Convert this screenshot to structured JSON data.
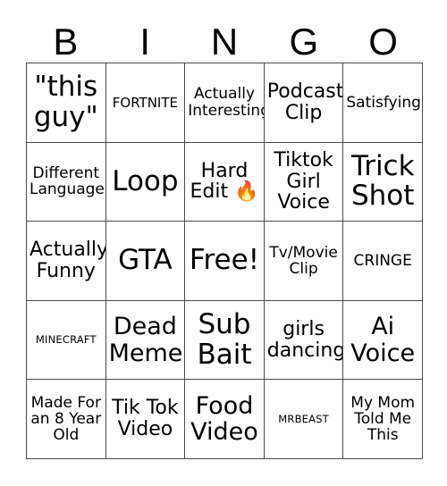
{
  "card": {
    "header": {
      "letters": [
        "B",
        "I",
        "N",
        "G",
        "O"
      ]
    },
    "rows": [
      [
        {
          "text": "\"this guy\"",
          "size": "sz-xl"
        },
        {
          "text": "FORTNITE",
          "size": "sz-xs"
        },
        {
          "text": "Actually Interesting",
          "size": "sz-sm"
        },
        {
          "text": "Podcast Clip",
          "size": "sz-md"
        },
        {
          "text": "Satisfying",
          "size": "sz-sm"
        }
      ],
      [
        {
          "text": "Different Language",
          "size": "sz-sm"
        },
        {
          "text": "Loop",
          "size": "sz-xl"
        },
        {
          "text": "Hard Edit 🔥",
          "size": "sz-md"
        },
        {
          "text": "Tiktok Girl Voice",
          "size": "sz-md"
        },
        {
          "text": "Trick Shot",
          "size": "sz-xl"
        }
      ],
      [
        {
          "text": "Actually Funny",
          "size": "sz-md"
        },
        {
          "text": "GTA",
          "size": "sz-xl"
        },
        {
          "text": "Free!",
          "size": "sz-xl"
        },
        {
          "text": "Tv/Movie Clip",
          "size": "sz-sm"
        },
        {
          "text": "CRINGE",
          "size": "sz-sm"
        }
      ],
      [
        {
          "text": "MINECRAFT",
          "size": "sz-xxs"
        },
        {
          "text": "Dead Meme",
          "size": "sz-lg"
        },
        {
          "text": "Sub Bait",
          "size": "sz-xl"
        },
        {
          "text": "girls dancing",
          "size": "sz-md"
        },
        {
          "text": "Ai Voice",
          "size": "sz-lg"
        }
      ],
      [
        {
          "text": "Made For an 8 Year Old",
          "size": "sz-sm"
        },
        {
          "text": "Tik Tok Video",
          "size": "sz-md"
        },
        {
          "text": "Food Video",
          "size": "sz-lg"
        },
        {
          "text": "MRBEAST",
          "size": "sz-xxs"
        },
        {
          "text": "My Mom Told Me This",
          "size": "sz-sm"
        }
      ]
    ]
  }
}
